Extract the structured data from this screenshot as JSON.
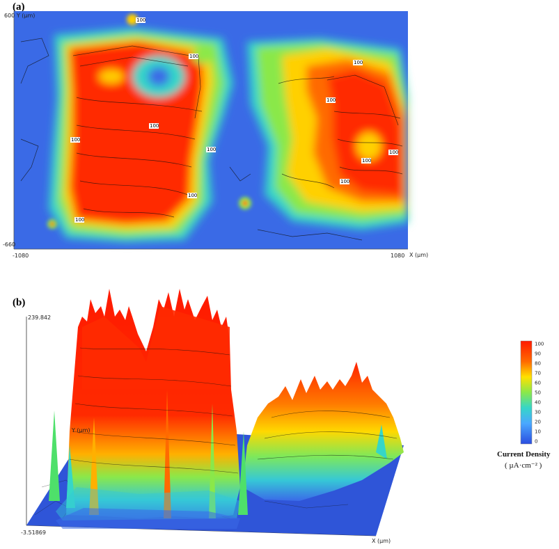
{
  "chart_data": [
    {
      "type": "heatmap",
      "panel": "(a)",
      "xlabel": "X (µm)",
      "ylabel": "Y (µm)",
      "x_ticks": [
        "-1080",
        "1080"
      ],
      "y_ticks": [
        "600",
        "-660"
      ],
      "xlim": [
        -1080,
        1080
      ],
      "ylim": [
        -660,
        600
      ],
      "contour_label": "100",
      "contour_labels_count": 12
    },
    {
      "type": "area",
      "panel": "(b)",
      "xlabel": "X (µm)",
      "ylabel": "Y (µm)",
      "zlim": [
        -3.51869,
        239.842
      ],
      "z_ticks": [
        "239.842",
        "-3.51869"
      ]
    }
  ],
  "colorbar": {
    "title": "Current Density",
    "unit": "( µA·cm⁻² )",
    "ticks": [
      "100",
      "90",
      "80",
      "70",
      "60",
      "50",
      "40",
      "30",
      "20",
      "10",
      "0"
    ],
    "colors": [
      "#ff1a00",
      "#ff3300",
      "#ff6a00",
      "#ffb000",
      "#ffe100",
      "#b6f03c",
      "#4ee06a",
      "#36d6c8",
      "#4aa8ff",
      "#3a78f0",
      "#2a4de0"
    ]
  },
  "labels": {
    "panel_a": "(a)",
    "panel_b": "(b)",
    "a_x_min": "-1080",
    "a_x_max": "1080",
    "a_y_max": "600 Y (µm)",
    "a_y_min": "-660",
    "a_x_axis": "X (µm)",
    "b_z_max": "239.842",
    "b_z_min": "-3.51869",
    "b_y_axis": "Y (µm)",
    "b_x_axis": "X (µm)"
  }
}
